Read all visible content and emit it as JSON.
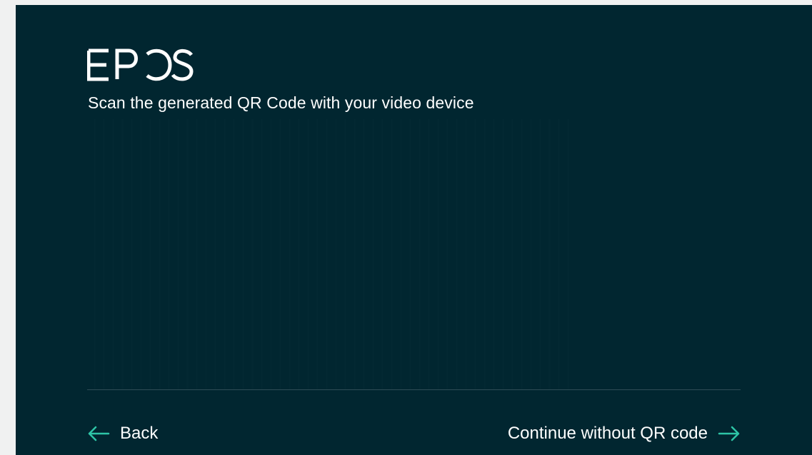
{
  "brand": {
    "logo_text": "EPOS"
  },
  "instruction": "Scan the generated QR Code with your video device",
  "footer": {
    "back_label": "Back",
    "continue_label": "Continue without QR code"
  },
  "icons": {
    "back": "arrow-left-icon",
    "continue": "arrow-right-icon"
  },
  "colors": {
    "background": "#012630",
    "outer_background": "#f0f1f1",
    "accent": "#2ec4a6",
    "text": "#ffffff",
    "divider": "#2f4d56"
  }
}
